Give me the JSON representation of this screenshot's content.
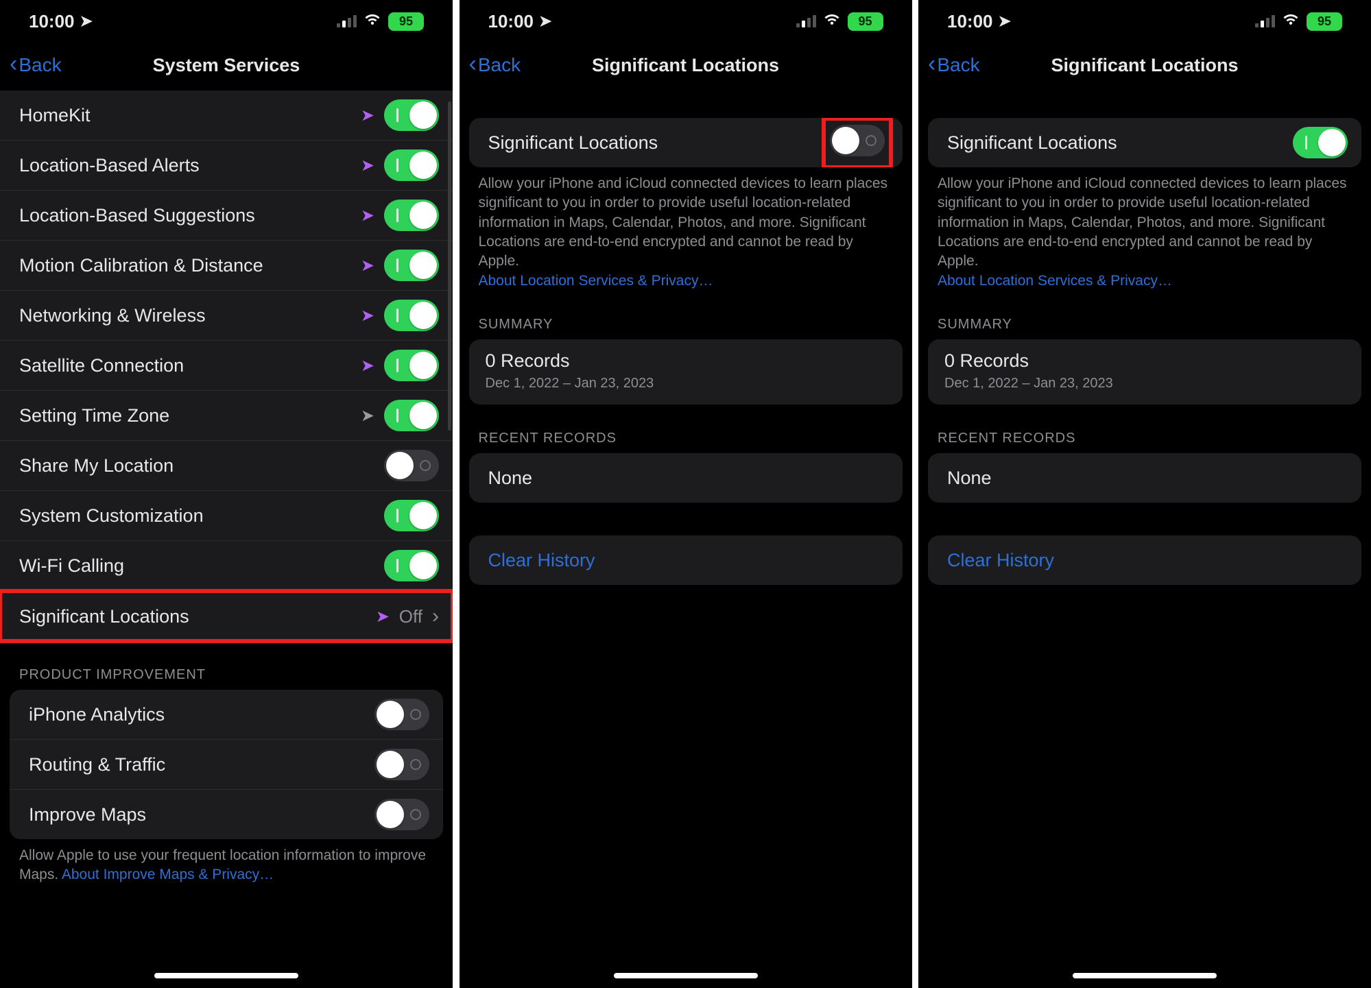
{
  "status": {
    "time": "10:00",
    "battery": "95"
  },
  "screens": {
    "a": {
      "back": "Back",
      "title": "System Services",
      "rows": [
        {
          "label": "HomeKit",
          "arrow": "purple",
          "toggle": "on"
        },
        {
          "label": "Location-Based Alerts",
          "arrow": "purple",
          "toggle": "on"
        },
        {
          "label": "Location-Based Suggestions",
          "arrow": "purple",
          "toggle": "on"
        },
        {
          "label": "Motion Calibration & Distance",
          "arrow": "purple",
          "toggle": "on"
        },
        {
          "label": "Networking & Wireless",
          "arrow": "purple",
          "toggle": "on"
        },
        {
          "label": "Satellite Connection",
          "arrow": "purple",
          "toggle": "on"
        },
        {
          "label": "Setting Time Zone",
          "arrow": "grey",
          "toggle": "on"
        },
        {
          "label": "Share My Location",
          "toggle": "off"
        },
        {
          "label": "System Customization",
          "toggle": "on"
        },
        {
          "label": "Wi-Fi Calling",
          "toggle": "on"
        }
      ],
      "sigloc": {
        "label": "Significant Locations",
        "value": "Off"
      },
      "section2_header": "PRODUCT IMPROVEMENT",
      "rows2": [
        {
          "label": "iPhone Analytics",
          "toggle": "off"
        },
        {
          "label": "Routing & Traffic",
          "toggle": "off"
        },
        {
          "label": "Improve Maps",
          "toggle": "off"
        }
      ],
      "footer_text": "Allow Apple to use your frequent location information to improve Maps. ",
      "footer_link": "About Improve Maps & Privacy…"
    },
    "b": {
      "back": "Back",
      "title": "Significant Locations",
      "toggle_label": "Significant Locations",
      "toggle": "off",
      "desc": "Allow your iPhone and iCloud connected devices to learn places significant to you in order to provide useful location-related information in Maps, Calendar, Photos, and more. Significant Locations are end-to-end encrypted and cannot be read by Apple.",
      "desc_link": "About Location Services & Privacy…",
      "summary_header": "SUMMARY",
      "summary_main": "0 Records",
      "summary_sub": "Dec 1, 2022 – Jan 23, 2023",
      "recent_header": "RECENT RECORDS",
      "recent_value": "None",
      "clear": "Clear History"
    },
    "c": {
      "back": "Back",
      "title": "Significant Locations",
      "toggle_label": "Significant Locations",
      "toggle": "on",
      "desc": "Allow your iPhone and iCloud connected devices to learn places significant to you in order to provide useful location-related information in Maps, Calendar, Photos, and more. Significant Locations are end-to-end encrypted and cannot be read by Apple.",
      "desc_link": "About Location Services & Privacy…",
      "summary_header": "SUMMARY",
      "summary_main": "0 Records",
      "summary_sub": "Dec 1, 2022 – Jan 23, 2023",
      "recent_header": "RECENT RECORDS",
      "recent_value": "None",
      "clear": "Clear History"
    }
  }
}
